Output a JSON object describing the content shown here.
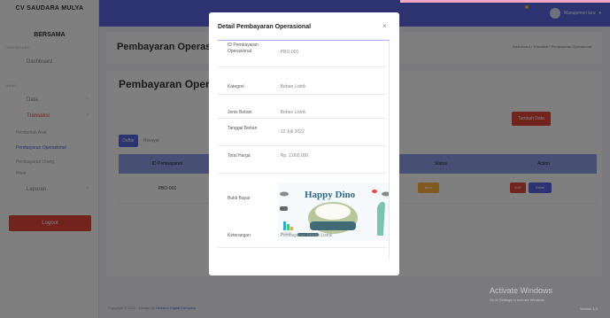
{
  "sidebar": {
    "brand_line1": "CV SAUDARA MULYA",
    "brand_line2": "BERSAMA",
    "section_dashboard": "DASHBOARD",
    "dashboard": "Dashboard",
    "section_menu": "MENU",
    "data": "Data",
    "transaksi": "Transaksi",
    "pembelian_aset": "Pembelian Aset",
    "pembayaran_operasional": "Pembayaran Operasional",
    "pembayaran_utang": "Pembayaran Utang",
    "prive": "Prive",
    "laporan": "Laporan",
    "logout": "Logout"
  },
  "topbar": {
    "user_name": "Manajemen keu"
  },
  "page": {
    "title": "Pembayaran Operasio",
    "breadcrumb": "Dashboard / Transaksi / Pembayaran Operasional",
    "section_title": "Pembayaran Oper",
    "add_button": "Tambah Data",
    "tabs": [
      "Daftar",
      "Riwayat"
    ]
  },
  "table": {
    "columns": [
      "ID Pembayaran",
      "Status",
      "Action"
    ],
    "rows": [
      {
        "id": "PBO-001",
        "status": "Baru",
        "edit": "Edit",
        "detail": "Detail"
      }
    ]
  },
  "footer": {
    "copyright": "Copyright © 2022 • Design By ",
    "brand": "Hexalon Digital Company"
  },
  "watermark": {
    "title": "Activate Windows",
    "subtitle": "Go to Settings to activate Windows.",
    "version": "Version 1.0"
  },
  "modal": {
    "title": "Detail Pembayaran Operasional",
    "close": "×",
    "rows": [
      {
        "label": "ID Pembayaran Operasional",
        "value": ": PBO-001"
      },
      {
        "label": "Kategori",
        "value": ": Beban Listrik"
      },
      {
        "label": "Jenis Beban",
        "value": ": Beban Listrik"
      },
      {
        "label": "Tanggal Beban",
        "value": ": 12 Juli 2022"
      },
      {
        "label": "Total Harga",
        "value": ": Rp. 2.000.000"
      },
      {
        "label": "Bukti Bayar",
        "value": ""
      },
      {
        "label": "Keterangan",
        "value": ": Pembayaran Beban Listrik"
      }
    ],
    "proof_image_text": "Happy Dino"
  },
  "colors": {
    "primary": "#5a66e0",
    "danger": "#e5473d",
    "warning": "#ffb33c"
  }
}
